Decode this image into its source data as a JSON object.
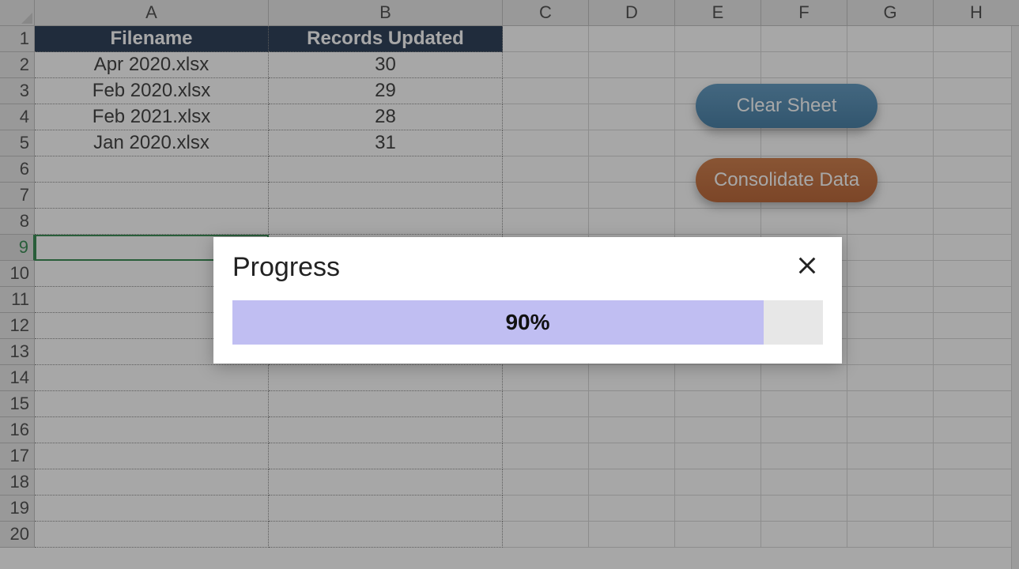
{
  "columns": [
    "A",
    "B",
    "C",
    "D",
    "E",
    "F",
    "G",
    "H"
  ],
  "row_count": 20,
  "selected_row": 9,
  "headers": {
    "A": "Filename",
    "B": "Records Updated"
  },
  "data_rows": [
    {
      "A": "Apr 2020.xlsx",
      "B": "30"
    },
    {
      "A": "Feb 2020.xlsx",
      "B": "29"
    },
    {
      "A": "Feb 2021.xlsx",
      "B": "28"
    },
    {
      "A": "Jan 2020.xlsx",
      "B": "31"
    }
  ],
  "buttons": {
    "clear": "Clear Sheet",
    "consolidate": "Consolidate Data"
  },
  "dialog": {
    "title": "Progress",
    "percent": 90,
    "percent_label": "90%"
  }
}
